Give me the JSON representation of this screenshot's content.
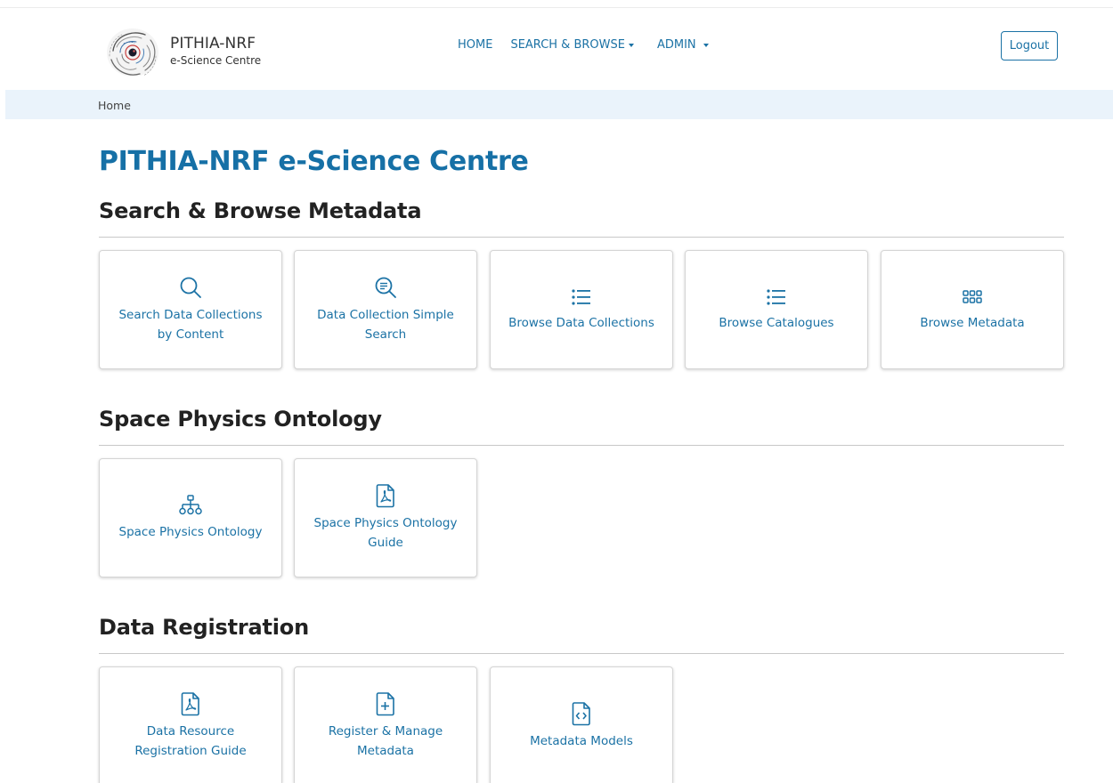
{
  "brand": {
    "name": "PITHIA-NRF",
    "subtitle": "e-Science Centre"
  },
  "nav": {
    "home": "HOME",
    "search_browse": "SEARCH & BROWSE",
    "admin": "ADMIN",
    "logout": "Logout"
  },
  "breadcrumb": {
    "current": "Home"
  },
  "page_title": "PITHIA-NRF e-Science Centre",
  "sections": [
    {
      "heading": "Search & Browse Metadata",
      "cards": [
        {
          "label": "Search Data Collections by Content",
          "icon": "search-icon"
        },
        {
          "label": "Data Collection Simple Search",
          "icon": "search-text-icon"
        },
        {
          "label": "Browse Data Collections",
          "icon": "list-icon"
        },
        {
          "label": "Browse Catalogues",
          "icon": "list-icon"
        },
        {
          "label": "Browse Metadata",
          "icon": "grid-icon"
        }
      ]
    },
    {
      "heading": "Space Physics Ontology",
      "cards": [
        {
          "label": "Space Physics Ontology",
          "icon": "hierarchy-icon"
        },
        {
          "label": "Space Physics Ontology Guide",
          "icon": "pdf-file-icon"
        }
      ]
    },
    {
      "heading": "Data Registration",
      "cards": [
        {
          "label": "Data Resource Registration Guide",
          "icon": "pdf-file-icon"
        },
        {
          "label": "Register & Manage Metadata",
          "icon": "file-plus-icon"
        },
        {
          "label": "Metadata Models",
          "icon": "file-code-icon"
        }
      ]
    }
  ],
  "colors": {
    "accent": "#1b72a5",
    "title": "#1670a6",
    "breadcrumb_bg": "#eaf3fb"
  }
}
